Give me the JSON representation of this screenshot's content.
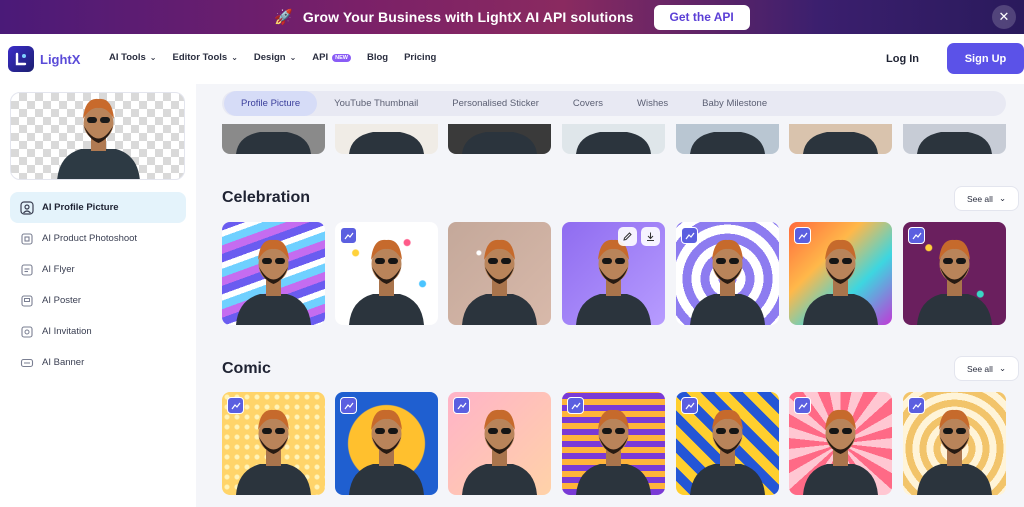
{
  "promo": {
    "rocket_icon": "rocket-icon",
    "text": "Grow Your Business with LightX AI API solutions",
    "cta": "Get the API",
    "close_icon": "close-icon"
  },
  "nav": {
    "brand": "LightX",
    "items": [
      {
        "label": "AI Tools",
        "has_dropdown": true
      },
      {
        "label": "Editor Tools",
        "has_dropdown": true
      },
      {
        "label": "Design",
        "has_dropdown": true
      },
      {
        "label": "API",
        "badge": "NEW"
      },
      {
        "label": "Blog"
      },
      {
        "label": "Pricing"
      }
    ],
    "login": "Log In",
    "signup": "Sign Up"
  },
  "sidebar": {
    "items": [
      {
        "label": "AI Profile Picture",
        "icon": "profile-picture-icon",
        "active": true
      },
      {
        "label": "AI Product Photoshoot",
        "icon": "product-photoshoot-icon"
      },
      {
        "label": "AI Flyer",
        "icon": "flyer-icon"
      },
      {
        "label": "AI Poster",
        "icon": "poster-icon"
      },
      {
        "label": "AI Invitation",
        "icon": "invitation-icon"
      },
      {
        "label": "AI Banner",
        "icon": "banner-icon"
      }
    ]
  },
  "tabs": [
    "Profile Picture",
    "YouTube Thumbnail",
    "Personalised Sticker",
    "Covers",
    "Wishes",
    "Baby Milestone"
  ],
  "sections": [
    {
      "title": "Celebration",
      "see_all": "See all"
    },
    {
      "title": "Comic",
      "see_all": "See all"
    }
  ],
  "colors": {
    "accent": "#5b52e8",
    "brand": "#5a4bd8",
    "active_tab_bg": "#d6dcf7",
    "sidebar_active_bg": "#e4f3fb"
  }
}
